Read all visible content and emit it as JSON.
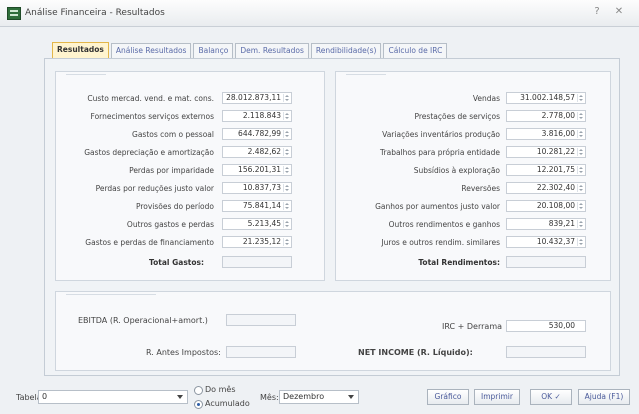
{
  "window": {
    "title": "Análise Financeira - Resultados",
    "help_label": "?",
    "close_label": "✕"
  },
  "tabs": [
    {
      "label": "Resultados"
    },
    {
      "label": "Análise Resultados"
    },
    {
      "label": "Balanço"
    },
    {
      "label": "Dem. Resultados"
    },
    {
      "label": "Rendibilidade(s)"
    },
    {
      "label": "Cálculo de IRC"
    }
  ],
  "left_group": {
    "rows": [
      {
        "label": "Custo mercad. vend. e mat. cons.",
        "value": "28.012.873,11"
      },
      {
        "label": "Fornecimentos serviços externos",
        "value": "2.118.843"
      },
      {
        "label": "Gastos com o pessoal",
        "value": "644.782,99"
      },
      {
        "label": "Gastos depreciação e amortização",
        "value": "2.482,62"
      },
      {
        "label": "Perdas por imparidade",
        "value": "156.201,31"
      },
      {
        "label": "Perdas por reduções justo valor",
        "value": "10.837,73"
      },
      {
        "label": "Provisões do período",
        "value": "75.841,14"
      },
      {
        "label": "Outros gastos e perdas",
        "value": "5.213,45"
      },
      {
        "label": "Gastos e perdas de financiamento",
        "value": "21.235,12"
      }
    ],
    "total_label": "Total Gastos:"
  },
  "right_group": {
    "rows": [
      {
        "label": "Vendas",
        "value": "31.002.148,57"
      },
      {
        "label": "Prestações de serviços",
        "value": "2.778,00"
      },
      {
        "label": "Variações inventários produção",
        "value": "3.816,00"
      },
      {
        "label": "Trabalhos para própria entidade",
        "value": "10.281,22"
      },
      {
        "label": "Subsídios à exploração",
        "value": "12.201,75"
      },
      {
        "label": "Reversões",
        "value": "22.302,40"
      },
      {
        "label": "Ganhos por aumentos justo valor",
        "value": "20.108,00"
      },
      {
        "label": "Outros rendimentos e ganhos",
        "value": "839,21"
      },
      {
        "label": "Juros e outros rendim. similares",
        "value": "10.432,37"
      }
    ],
    "total_label": "Total Rendimentos:"
  },
  "lower_group": {
    "ebitda_label": "EBITDA (R. Operacional+amort.)",
    "r_label": "R. Antes Impostos:",
    "irc_label": "IRC + Derrama",
    "irc_value": "530,00",
    "net_label": "NET INCOME (R. Líquido):"
  },
  "footer": {
    "tabela_label": "Tabela",
    "tabela_value": "0",
    "radio1_label": "Do mês",
    "radio2_label": "Acumulado",
    "mes_label": "Mês:",
    "mes_value": "Dezembro",
    "grafico_btn": "Gráfico",
    "imprimir_btn": "Imprimir",
    "ok_btn": "OK ✓",
    "ajuda_btn": "Ajuda (F1)"
  }
}
